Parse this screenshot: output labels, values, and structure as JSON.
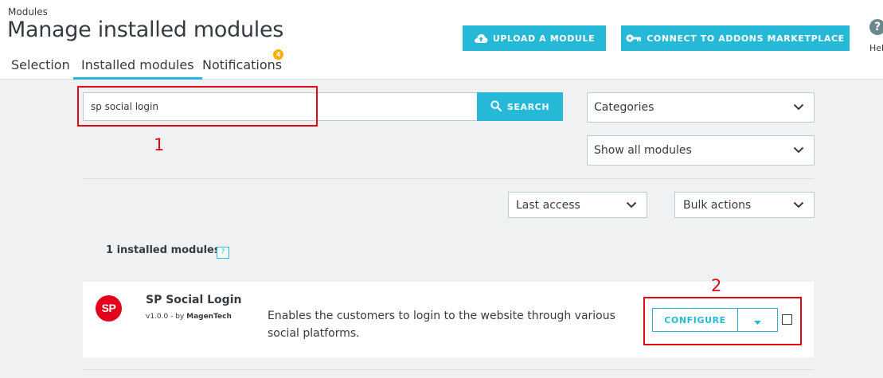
{
  "header": {
    "breadcrumb": "Modules",
    "title": "Manage installed modules",
    "tabs": [
      {
        "label": "Selection"
      },
      {
        "label": "Installed modules"
      },
      {
        "label": "Notifications",
        "badge": "4"
      }
    ],
    "upload_label": "UPLOAD A MODULE",
    "connect_label": "CONNECT TO ADDONS MARKETPLACE",
    "help_label": "Hel"
  },
  "filters": {
    "search_value": "sp social login",
    "search_button": "SEARCH",
    "categories": "Categories",
    "show_modules": "Show all modules",
    "sort": "Last access",
    "bulk": "Bulk actions"
  },
  "summary": {
    "installed_count": "1 installed modules",
    "help_glyph": "?"
  },
  "module": {
    "logo_text": "SP",
    "name": "SP Social Login",
    "version": "v1.0.0 - by",
    "author": "MagenTech",
    "description": "Enables the customers to login to the website through various social platforms.",
    "configure_label": "CONFIGURE"
  },
  "annotations": {
    "label_1": "1",
    "label_2": "2",
    "color": "#e30613"
  },
  "colors": {
    "accent": "#25b9d7",
    "badge": "#fab000"
  }
}
